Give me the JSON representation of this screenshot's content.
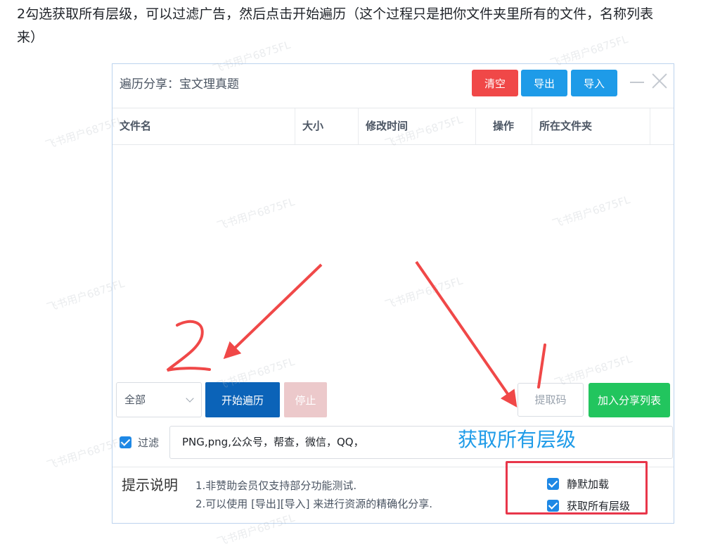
{
  "doc": {
    "line1": "2勾选获取所有层级，可以过滤广告，然后点击开始遍历（这个过程只是把你文件夹里所有的文件，名称列表",
    "line2": "来）"
  },
  "window": {
    "title": "遍历分享：宝文理真题",
    "buttons": {
      "clear": "清空",
      "export": "导出",
      "import": "导入"
    }
  },
  "table": {
    "columns": [
      "文件名",
      "大小",
      "修改时间",
      "操作",
      "所在文件夹"
    ],
    "rows": []
  },
  "controls": {
    "scope_select": "全部",
    "start_button": "开始遍历",
    "stop_button": "停止",
    "code_placeholder": "提取码",
    "add_button": "加入分享列表"
  },
  "filter": {
    "checked": true,
    "label": "过滤",
    "value": "PNG,png,公众号，帮查，微信，QQ，"
  },
  "tips": {
    "title": "提示说明",
    "line1": "1.非赞助会员仅支持部分功能测试.",
    "line2": "2.可以使用 [导出][导入] 来进行资源的精确化分享."
  },
  "options": {
    "silent_load": {
      "label": "静默加载",
      "checked": true
    },
    "all_levels": {
      "label": "获取所有层级",
      "checked": true
    }
  },
  "annotations": {
    "blue_text": "获取所有层级",
    "number_2": "2",
    "number_1": "1",
    "arrow_color": "#f04848",
    "box_color": "#e8364a"
  },
  "watermark": "飞书用户6875FL"
}
